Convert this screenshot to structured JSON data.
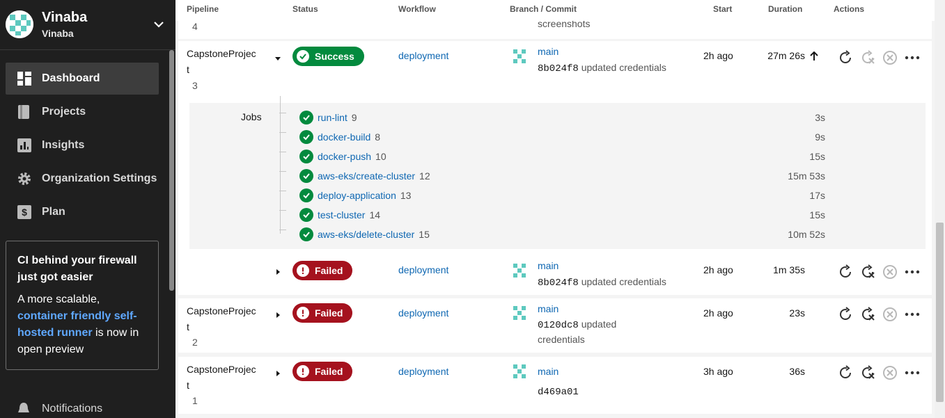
{
  "org": {
    "name": "Vinaba",
    "sub": "Vinaba"
  },
  "nav": [
    {
      "label": "Dashboard",
      "icon": "dashboard-icon",
      "active": true
    },
    {
      "label": "Projects",
      "icon": "projects-icon"
    },
    {
      "label": "Insights",
      "icon": "insights-icon"
    },
    {
      "label": "Organization Settings",
      "icon": "gear-icon"
    },
    {
      "label": "Plan",
      "icon": "plan-icon"
    }
  ],
  "promo": {
    "title": "CI behind your firewall just got easier",
    "body_pre": "A more scalable, ",
    "link": "container friendly self-hosted runner",
    "body_post": " is now in open preview"
  },
  "notifications": "Notifications",
  "header": {
    "pipeline": "Pipeline",
    "status": "Status",
    "workflow": "Workflow",
    "branch_commit": "Branch / Commit",
    "start": "Start",
    "duration": "Duration",
    "actions": "Actions"
  },
  "top_partial": {
    "number": "4",
    "commit_msg": "screenshots"
  },
  "rows": [
    {
      "pipeline": "CapstoneProjec\nt",
      "number": "3",
      "status": "Success",
      "workflow": "deployment",
      "branch": "main",
      "commit": "8b024f8",
      "message": "updated credentials",
      "start": "2h ago",
      "duration": "27m 26s"
    },
    {
      "pipeline": "",
      "number": "",
      "status": "Failed",
      "workflow": "deployment",
      "branch": "main",
      "commit": "8b024f8",
      "message": "updated credentials",
      "start": "2h ago",
      "duration": "1m 35s"
    },
    {
      "pipeline": "CapstoneProjec\nt",
      "number": "2",
      "status": "Failed",
      "workflow": "deployment",
      "branch": "main",
      "commit": "0120dc8",
      "message": "updated",
      "message2": "credentials",
      "start": "2h ago",
      "duration": "23s"
    },
    {
      "pipeline": "CapstoneProjec\nt",
      "number": "1",
      "status": "Failed",
      "workflow": "deployment",
      "branch": "main",
      "commit": "d469a01",
      "message": "",
      "start": "3h ago",
      "duration": "36s"
    }
  ],
  "jobs_label": "Jobs",
  "jobs": [
    {
      "name": "run-lint",
      "num": "9",
      "duration": "3s"
    },
    {
      "name": "docker-build",
      "num": "8",
      "duration": "9s"
    },
    {
      "name": "docker-push",
      "num": "10",
      "duration": "15s"
    },
    {
      "name": "aws-eks/create-cluster",
      "num": "12",
      "duration": "15m 53s"
    },
    {
      "name": "deploy-application",
      "num": "13",
      "duration": "17s"
    },
    {
      "name": "test-cluster",
      "num": "14",
      "duration": "15s"
    },
    {
      "name": "aws-eks/delete-cluster",
      "num": "15",
      "duration": "10m 52s"
    }
  ],
  "colors": {
    "success": "#038a3e",
    "failed": "#a5121e",
    "link": "#0e67b2",
    "sidebar": "#1f1f1f"
  }
}
